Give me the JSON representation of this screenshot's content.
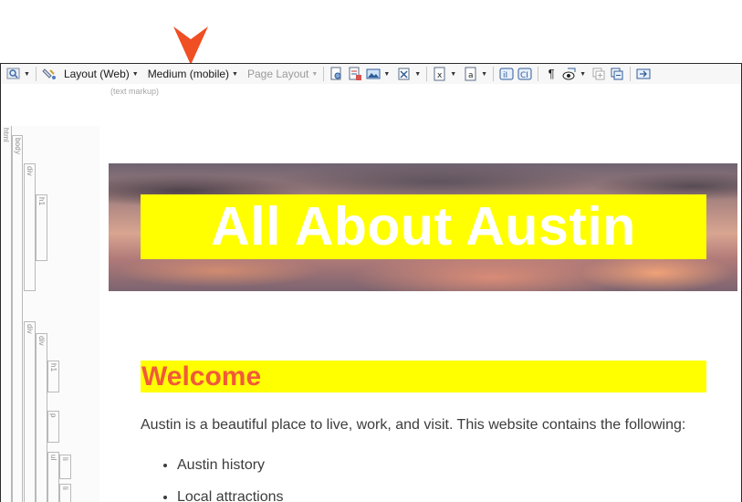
{
  "toolbar": {
    "layout_label": "Layout (Web)",
    "medium_label": "Medium (mobile)",
    "page_layout_label": "Page Layout"
  },
  "markup_label": "(text markup)",
  "structure_bars": [
    {
      "tag": "html"
    },
    {
      "tag": "body"
    },
    {
      "tag": "div"
    },
    {
      "tag": "h1"
    },
    {
      "tag": "div"
    },
    {
      "tag": "div"
    },
    {
      "tag": "h1"
    },
    {
      "tag": "p"
    },
    {
      "tag": "ul"
    },
    {
      "tag": "li"
    },
    {
      "tag": "li"
    }
  ],
  "content": {
    "hero_title": "All About Austin",
    "welcome_heading": "Welcome",
    "intro_text": "Austin is a beautiful place to live, work, and visit. This website contains the following:",
    "list_items": [
      "Austin history",
      "Local attractions"
    ]
  },
  "colors": {
    "highlight": "#ffff00",
    "heading": "#f15a3a",
    "callout": "#f04e23"
  }
}
